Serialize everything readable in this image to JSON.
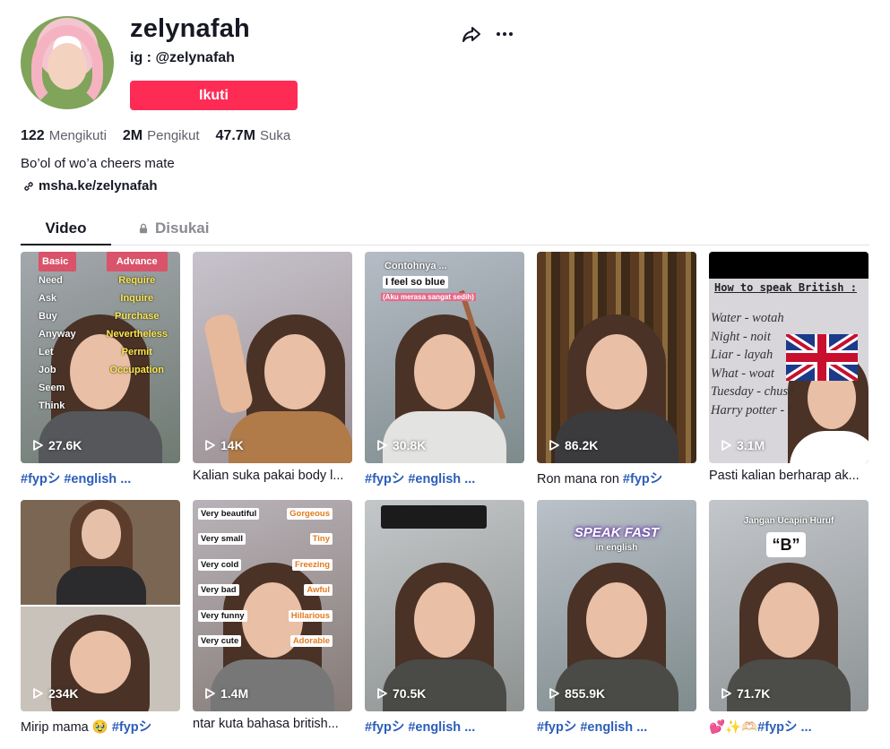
{
  "profile": {
    "username": "zelynafah",
    "subname": "ig : @zelynafah",
    "follow_label": "Ikuti",
    "bio": "Bo’ol of wo’a cheers mate",
    "link": "msha.ke/zelynafah",
    "stats": [
      {
        "num": "122",
        "label": "Mengikuti"
      },
      {
        "num": "2M",
        "label": "Pengikut"
      },
      {
        "num": "47.7M",
        "label": "Suka"
      }
    ]
  },
  "tabs": {
    "video": "Video",
    "liked": "Disukai"
  },
  "videos": [
    {
      "views": "27.6K",
      "caption": "#fypシ #english ...",
      "tagged": true
    },
    {
      "views": "14K",
      "caption": "Kalian suka pakai body l...",
      "tagged": false
    },
    {
      "views": "30.8K",
      "caption": "#fypシ #english ...",
      "tagged": true
    },
    {
      "views": "86.2K",
      "caption_plain": "Ron mana ron ",
      "caption_tag": "#fypシ",
      "mixed": true
    },
    {
      "views": "3.1M",
      "caption": "Pasti kalian berharap ak...",
      "tagged": false
    },
    {
      "views": "234K",
      "caption_plain": "Mirip mama 🥹 ",
      "caption_tag": "#fypシ",
      "mixed": true
    },
    {
      "views": "1.4M",
      "caption": "ntar kuta bahasa british...",
      "tagged": false
    },
    {
      "views": "70.5K",
      "caption": "#fypシ #english ...",
      "tagged": true
    },
    {
      "views": "855.9K",
      "caption": "#fypシ #english ...",
      "tagged": true
    },
    {
      "views": "71.7K",
      "caption_plain": "💕✨🫶🏻",
      "caption_tag": "#fypシ ...",
      "mixed": true
    }
  ],
  "overlays": {
    "v1_left": [
      "Basic",
      "Need",
      "Ask",
      "Buy",
      "Anyway",
      "Let",
      "Job",
      "Seem",
      "Think"
    ],
    "v1_right": [
      "Advance",
      "Require",
      "Inquire",
      "Purchase",
      "Nevertheless",
      "Permit",
      "Occupation"
    ],
    "v3_top": "Contohnya ...",
    "v3_pill": "I feel so blue",
    "v3_sub": "(Aku merasa sangat sedih)",
    "v5_title": "How to speak British :",
    "v5_lines": [
      "Water - wotah",
      "Night - noit",
      "Liar - layah",
      "What - woat",
      "Tuesday - chuse",
      "Harry potter - !"
    ],
    "v7_left": [
      "Very beautiful",
      "Very small",
      "Very cold",
      "Very bad",
      "Very funny",
      "Very cute"
    ],
    "v7_right": [
      "Gorgeous",
      "Tiny",
      "Freezing",
      "Awful",
      "Hillarious",
      "Adorable"
    ],
    "v9_title": "SPEAK FAST",
    "v9_sub": "in english",
    "v10_title": "Jangan Ucapin Huruf",
    "v10_letter": "“B”"
  },
  "colors": {
    "accent": "#fe2c55",
    "hashtag": "#2b5db9"
  }
}
